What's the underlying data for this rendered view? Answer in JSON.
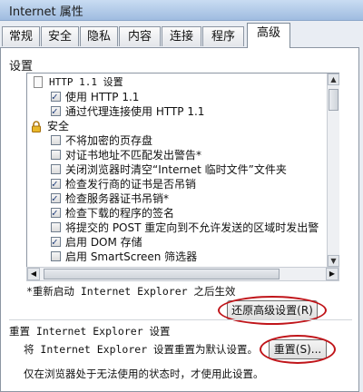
{
  "window": {
    "title": "Internet 属性"
  },
  "tabs": [
    {
      "label": "常规"
    },
    {
      "label": "安全"
    },
    {
      "label": "隐私"
    },
    {
      "label": "内容"
    },
    {
      "label": "连接"
    },
    {
      "label": "程序"
    },
    {
      "label": "高级",
      "active": true
    }
  ],
  "settings": {
    "group_label": "设置",
    "items": [
      {
        "type": "header",
        "icon": "document-icon",
        "label": "HTTP 1.1 设置"
      },
      {
        "type": "checkbox",
        "checked": true,
        "label": "使用 HTTP 1.1"
      },
      {
        "type": "checkbox",
        "checked": true,
        "label": "通过代理连接使用 HTTP 1.1"
      },
      {
        "type": "header",
        "icon": "lock-icon",
        "label": "安全"
      },
      {
        "type": "checkbox",
        "checked": false,
        "label": "不将加密的页存盘"
      },
      {
        "type": "checkbox",
        "checked": false,
        "label": "对证书地址不匹配发出警告*"
      },
      {
        "type": "checkbox",
        "checked": false,
        "label": "关闭浏览器时清空“Internet 临时文件”文件夹"
      },
      {
        "type": "checkbox",
        "checked": true,
        "label": "检查发行商的证书是否吊销"
      },
      {
        "type": "checkbox",
        "checked": true,
        "label": "检查服务器证书吊销*"
      },
      {
        "type": "checkbox",
        "checked": true,
        "label": "检查下载的程序的签名"
      },
      {
        "type": "checkbox",
        "checked": false,
        "label": "将提交的 POST 重定向到不允许发送的区域时发出警"
      },
      {
        "type": "checkbox",
        "checked": true,
        "label": "启用 DOM 存储"
      },
      {
        "type": "checkbox",
        "checked": false,
        "label": "启用 SmartScreen 筛选器"
      }
    ],
    "restart_note": "*重新启动 Internet Explorer 之后生效",
    "restore_button": "还原高级设置(R)"
  },
  "reset": {
    "title": "重置 Internet Explorer 设置",
    "description": "将 Internet Explorer 设置重置为默认设置。",
    "button": "重置(S)...",
    "note": "仅在浏览器处于无法使用的状态时，才使用此设置。"
  },
  "colors": {
    "highlight_ellipse": "#c0151a",
    "check_color": "#1e3d7b"
  }
}
